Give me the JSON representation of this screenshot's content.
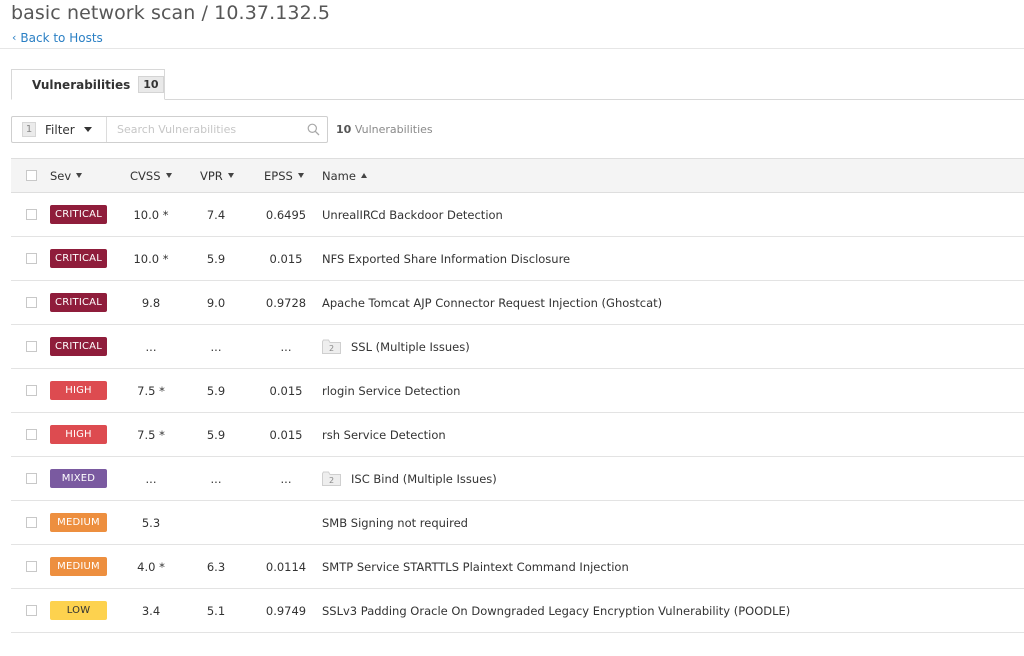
{
  "header": {
    "title": "basic network scan / 10.37.132.5",
    "back_label": "Back to Hosts"
  },
  "tabs": [
    {
      "label": "Vulnerabilities",
      "count": "10"
    }
  ],
  "toolbar": {
    "filter_count": "1",
    "filter_label": "Filter",
    "search_placeholder": "Search Vulnerabilities",
    "result_count": "10",
    "result_label": "Vulnerabilities"
  },
  "table": {
    "columns": {
      "sev": "Sev",
      "cvss": "CVSS",
      "vpr": "VPR",
      "epss": "EPSS",
      "name": "Name"
    },
    "rows": [
      {
        "sev": "CRITICAL",
        "sev_color": "#8f1d3b",
        "cvss": "10.0 *",
        "vpr": "7.4",
        "epss": "0.6495",
        "name": "UnrealIRCd Backdoor Detection",
        "group_count": ""
      },
      {
        "sev": "CRITICAL",
        "sev_color": "#8f1d3b",
        "cvss": "10.0 *",
        "vpr": "5.9",
        "epss": "0.015",
        "name": "NFS Exported Share Information Disclosure",
        "group_count": ""
      },
      {
        "sev": "CRITICAL",
        "sev_color": "#8f1d3b",
        "cvss": "9.8",
        "vpr": "9.0",
        "epss": "0.9728",
        "name": "Apache Tomcat AJP Connector Request Injection (Ghostcat)",
        "group_count": ""
      },
      {
        "sev": "CRITICAL",
        "sev_color": "#8f1d3b",
        "cvss": "...",
        "vpr": "...",
        "epss": "...",
        "name": "SSL (Multiple Issues)",
        "group_count": "2"
      },
      {
        "sev": "HIGH",
        "sev_color": "#dd4b50",
        "cvss": "7.5 *",
        "vpr": "5.9",
        "epss": "0.015",
        "name": "rlogin Service Detection",
        "group_count": ""
      },
      {
        "sev": "HIGH",
        "sev_color": "#dd4b50",
        "cvss": "7.5 *",
        "vpr": "5.9",
        "epss": "0.015",
        "name": "rsh Service Detection",
        "group_count": ""
      },
      {
        "sev": "MIXED",
        "sev_color": "#7a5aa0",
        "cvss": "...",
        "vpr": "...",
        "epss": "...",
        "name": "ISC Bind (Multiple Issues)",
        "group_count": "2"
      },
      {
        "sev": "MEDIUM",
        "sev_color": "#ed8f3f",
        "cvss": "5.3",
        "vpr": "",
        "epss": "",
        "name": "SMB Signing not required",
        "group_count": ""
      },
      {
        "sev": "MEDIUM",
        "sev_color": "#ed8f3f",
        "cvss": "4.0 *",
        "vpr": "6.3",
        "epss": "0.0114",
        "name": "SMTP Service STARTTLS Plaintext Command Injection",
        "group_count": ""
      },
      {
        "sev": "LOW",
        "sev_color": "#fdd24e",
        "cvss": "3.4",
        "vpr": "5.1",
        "epss": "0.9749",
        "name": "SSLv3 Padding Oracle On Downgraded Legacy Encryption Vulnerability (POODLE)",
        "group_count": ""
      }
    ]
  }
}
